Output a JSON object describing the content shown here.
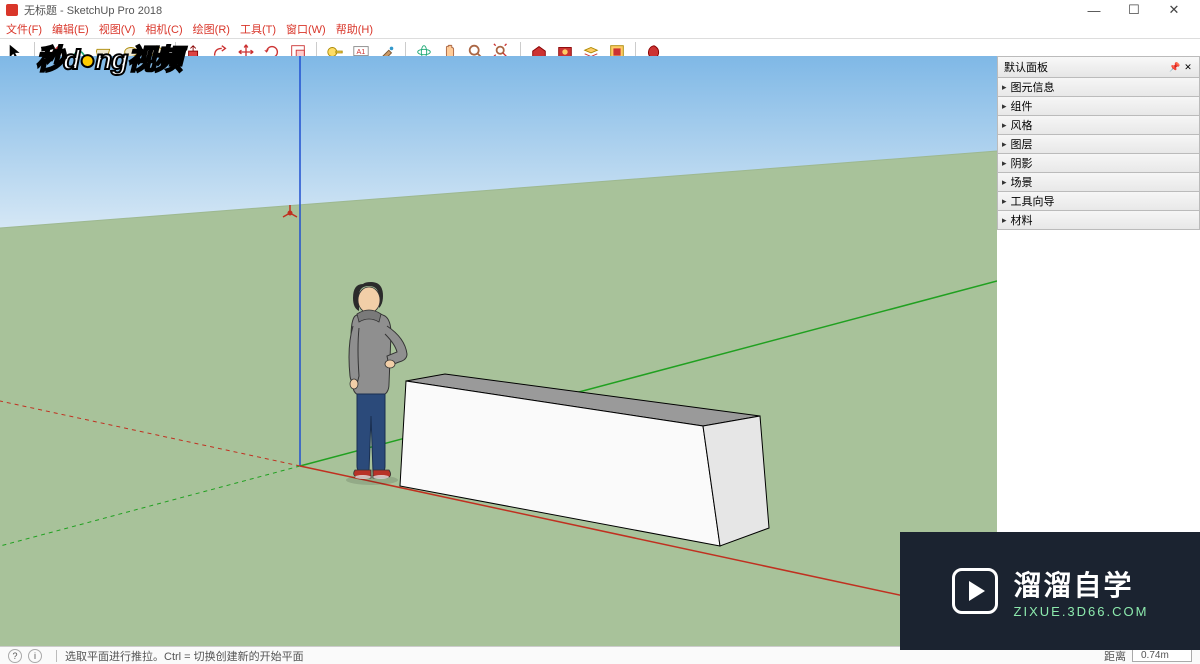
{
  "window": {
    "title": "无标题 - SketchUp Pro 2018",
    "controls": {
      "min": "—",
      "max": "☐",
      "close": "✕"
    }
  },
  "menu": [
    "文件(F)",
    "编辑(E)",
    "视图(V)",
    "相机(C)",
    "绘图(R)",
    "工具(T)",
    "窗口(W)",
    "帮助(H)"
  ],
  "panel": {
    "title": "默认面板",
    "items": [
      "图元信息",
      "组件",
      "风格",
      "图层",
      "阴影",
      "场景",
      "工具向导",
      "材料"
    ]
  },
  "status": {
    "hint": "选取平面进行推拉。Ctrl = 切换创建新的开始平面",
    "measure_label": "距离",
    "measure_value": "0.74m"
  },
  "watermarks": {
    "top": {
      "a": "秒d",
      "b": "ng视频"
    },
    "site": {
      "brand": "溜溜自学",
      "url": "ZIXUE.3D66.COM"
    }
  }
}
